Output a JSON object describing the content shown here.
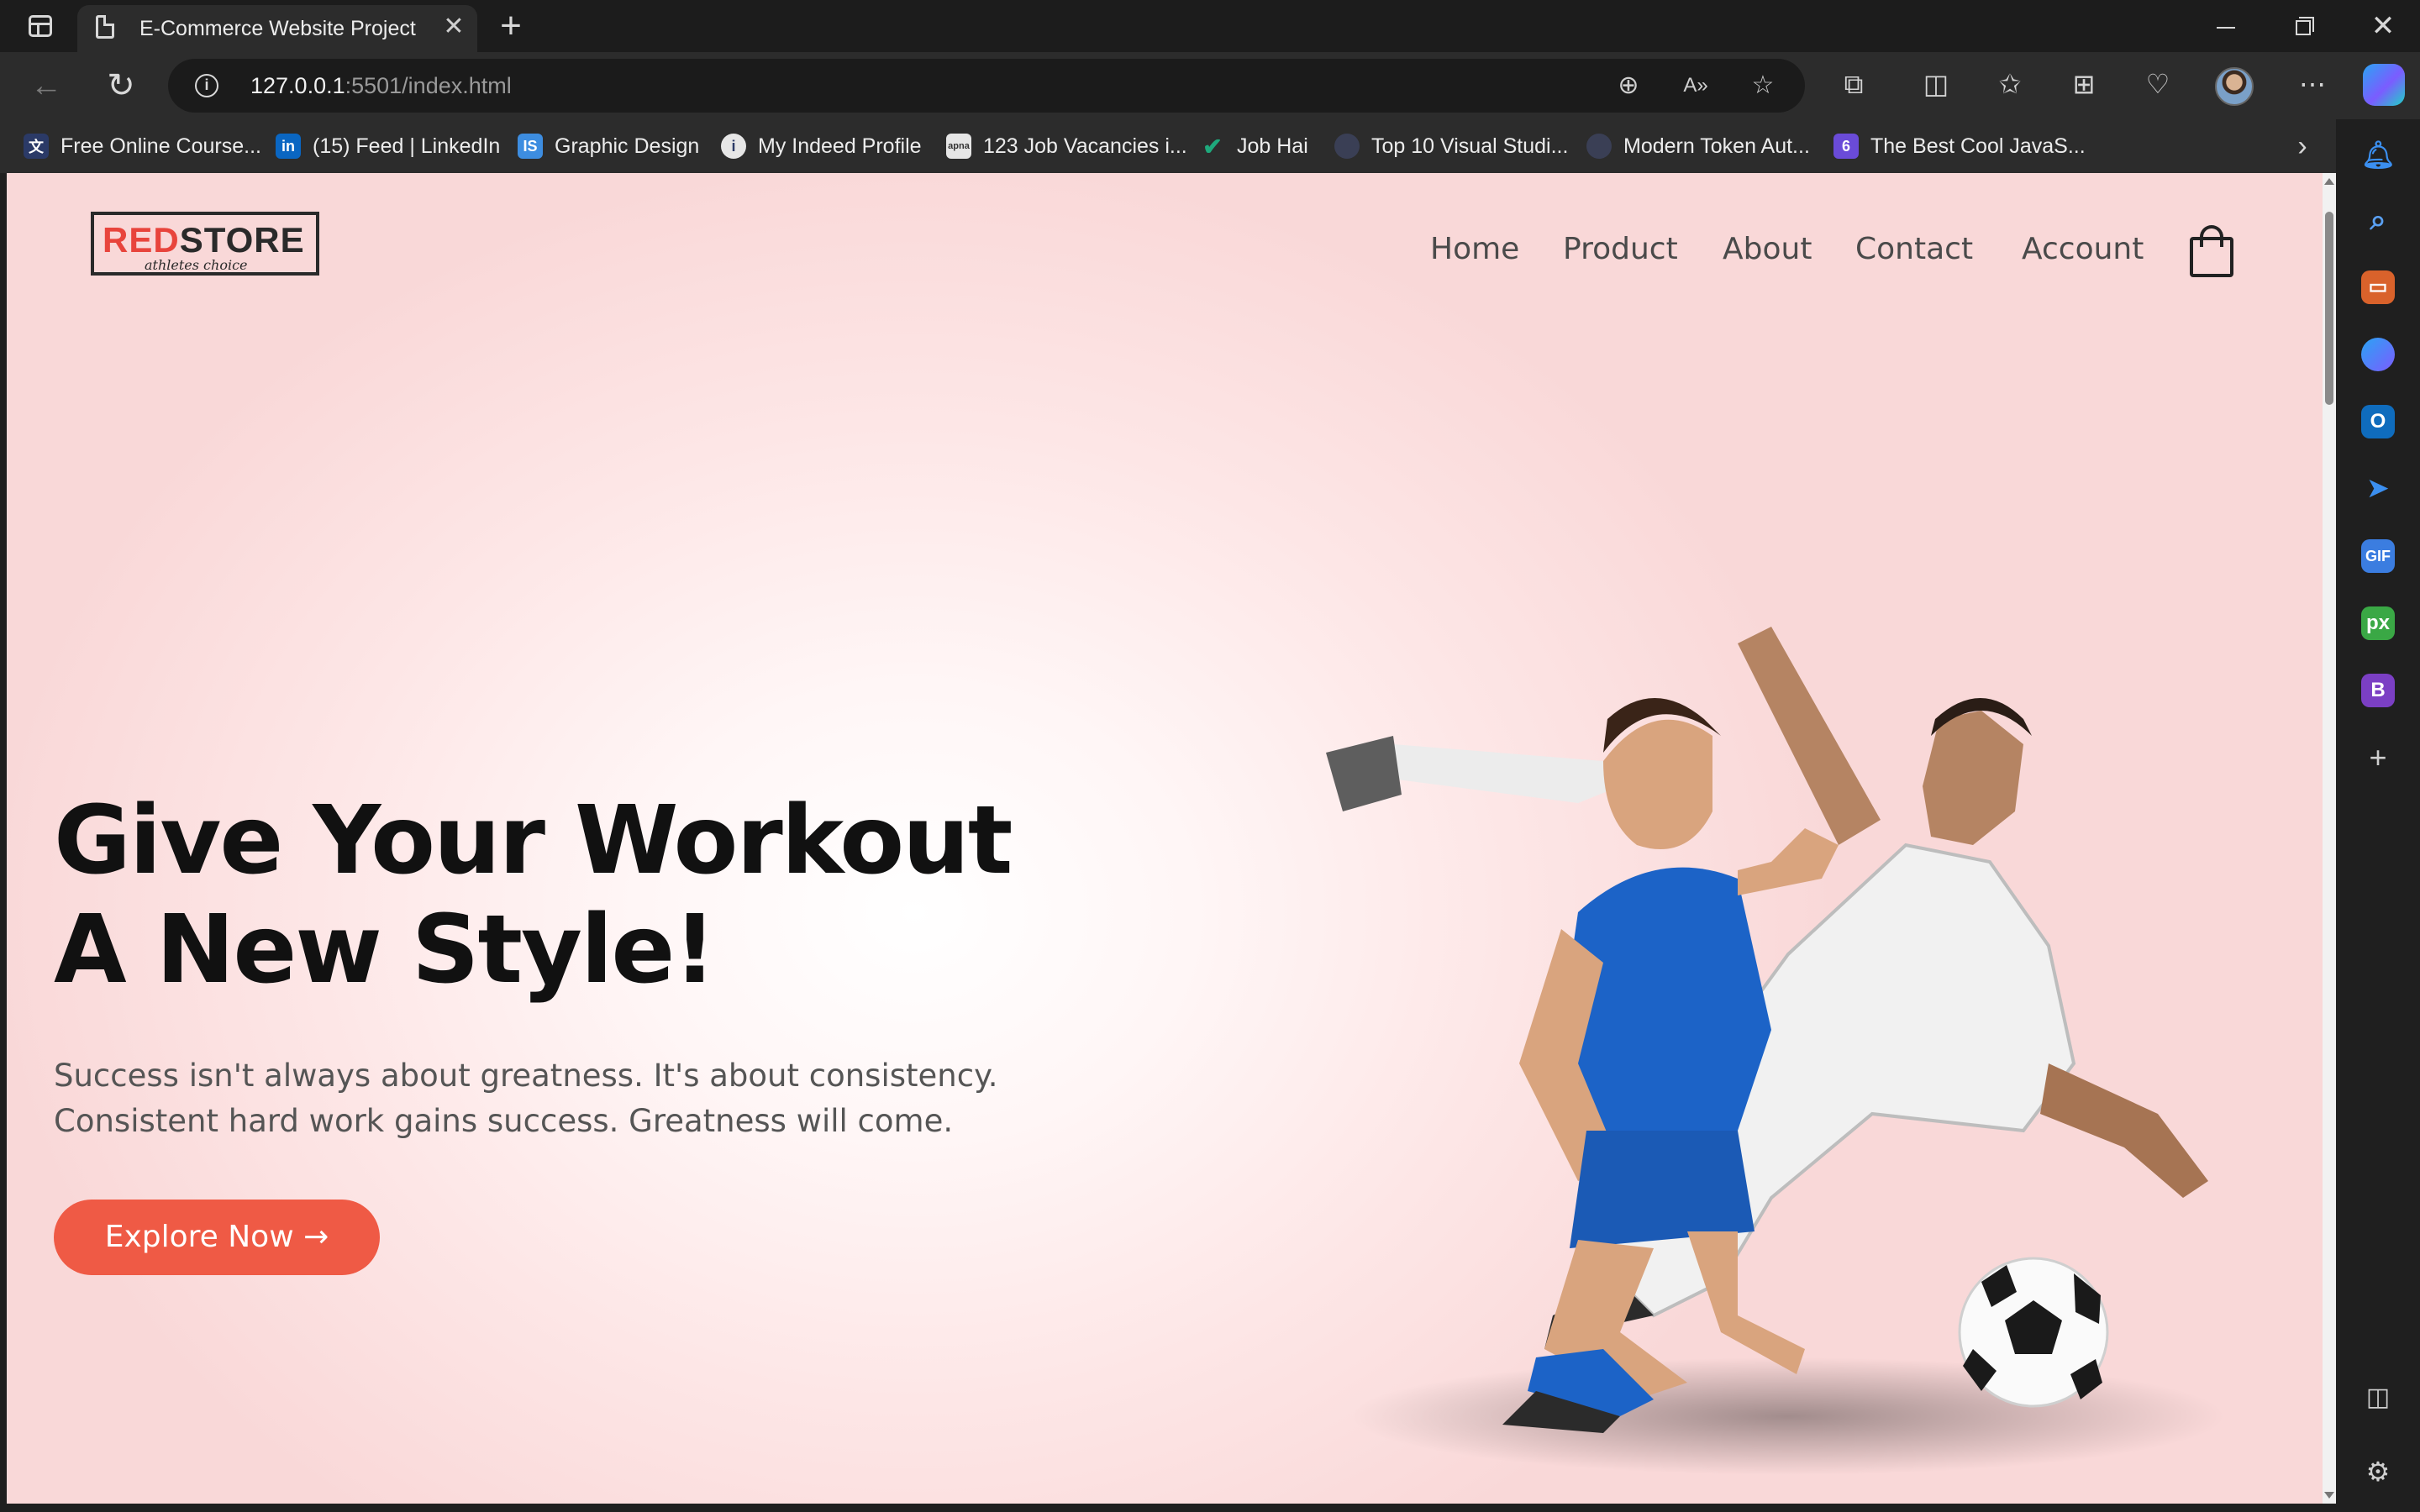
{
  "browser": {
    "tab_title": "E-Commerce Website Project",
    "tab_close": "✕",
    "new_tab": "+",
    "url_host": "127.0.0.1",
    "url_rest": ":5501/index.html",
    "window_close": "✕"
  },
  "bookmarks": [
    {
      "label": "Free Online Course...",
      "icon": "translate-icon",
      "color": "#2b3a67"
    },
    {
      "label": "(15) Feed | LinkedIn",
      "icon": "linkedin-icon",
      "color": "#0a66c2"
    },
    {
      "label": "Graphic Design",
      "icon": "is-icon",
      "color": "#3d8de0"
    },
    {
      "label": "My Indeed Profile",
      "icon": "info-icon",
      "color": "#e6e6e6"
    },
    {
      "label": "123 Job Vacancies i...",
      "icon": "apna-icon",
      "color": "#e6e6e6"
    },
    {
      "label": "Job Hai",
      "icon": "check-icon",
      "color": "#1ea97c"
    },
    {
      "label": "Top 10 Visual Studi...",
      "icon": "circle-icon",
      "color": "#3a3f55"
    },
    {
      "label": "Modern Token Aut...",
      "icon": "circle-icon",
      "color": "#3a3f55"
    },
    {
      "label": "The Best Cool JavaS...",
      "icon": "six-icon",
      "color": "#6a4bd8"
    }
  ],
  "site": {
    "logo_red": "RED",
    "logo_dark": "STORE",
    "logo_tagline": "athletes choice",
    "menu": [
      "Home",
      "Product",
      "About",
      "Contact",
      "Account"
    ],
    "hero_title_line1": "Give Your Workout",
    "hero_title_line2": "A New Style!",
    "hero_text": "Success isn't always about greatness. It's about consistency. Consistent hard work gains success. Greatness will come.",
    "cta_label": "Explore Now →",
    "accent_color": "#ef5a45"
  }
}
